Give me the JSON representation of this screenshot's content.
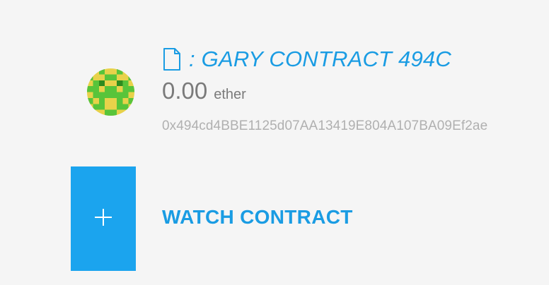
{
  "contract": {
    "name": ": GARY CONTRACT 494C",
    "balance": "0.00",
    "unit": "ether",
    "address": "0x494cd4BBE1125d07AA13419E804A107BA09Ef2ae",
    "icon": "document-icon"
  },
  "watch": {
    "label": "WATCH CONTRACT",
    "icon": "plus-icon"
  },
  "colors": {
    "accent": "#1a9ce3",
    "tile": "#1ba4ee",
    "identicon_yellow": "#e8d24a",
    "identicon_green": "#58c43a"
  }
}
